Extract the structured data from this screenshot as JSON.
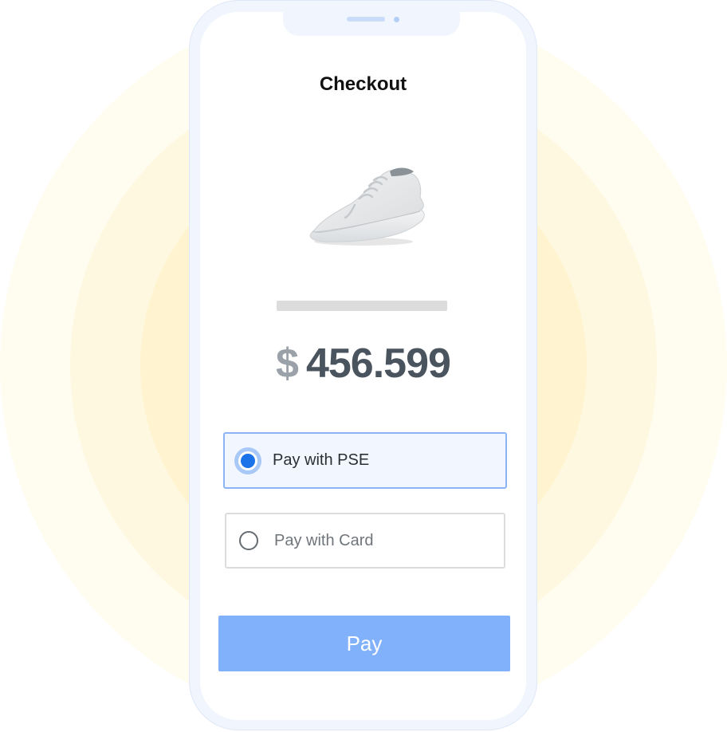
{
  "screen": {
    "title": "Checkout"
  },
  "product": {
    "image_icon": "sneaker-image"
  },
  "price": {
    "currency_symbol": "$",
    "amount": "456.599"
  },
  "payment_options": [
    {
      "label": "Pay with PSE",
      "selected": true
    },
    {
      "label": "Pay with Card",
      "selected": false
    }
  ],
  "pay_button": {
    "label": "Pay"
  },
  "colors": {
    "accent": "#1a73e8",
    "pay_button": "#80b1fa",
    "selected_option_border": "#8ab4f4",
    "background_glow": "#fff4cf"
  }
}
